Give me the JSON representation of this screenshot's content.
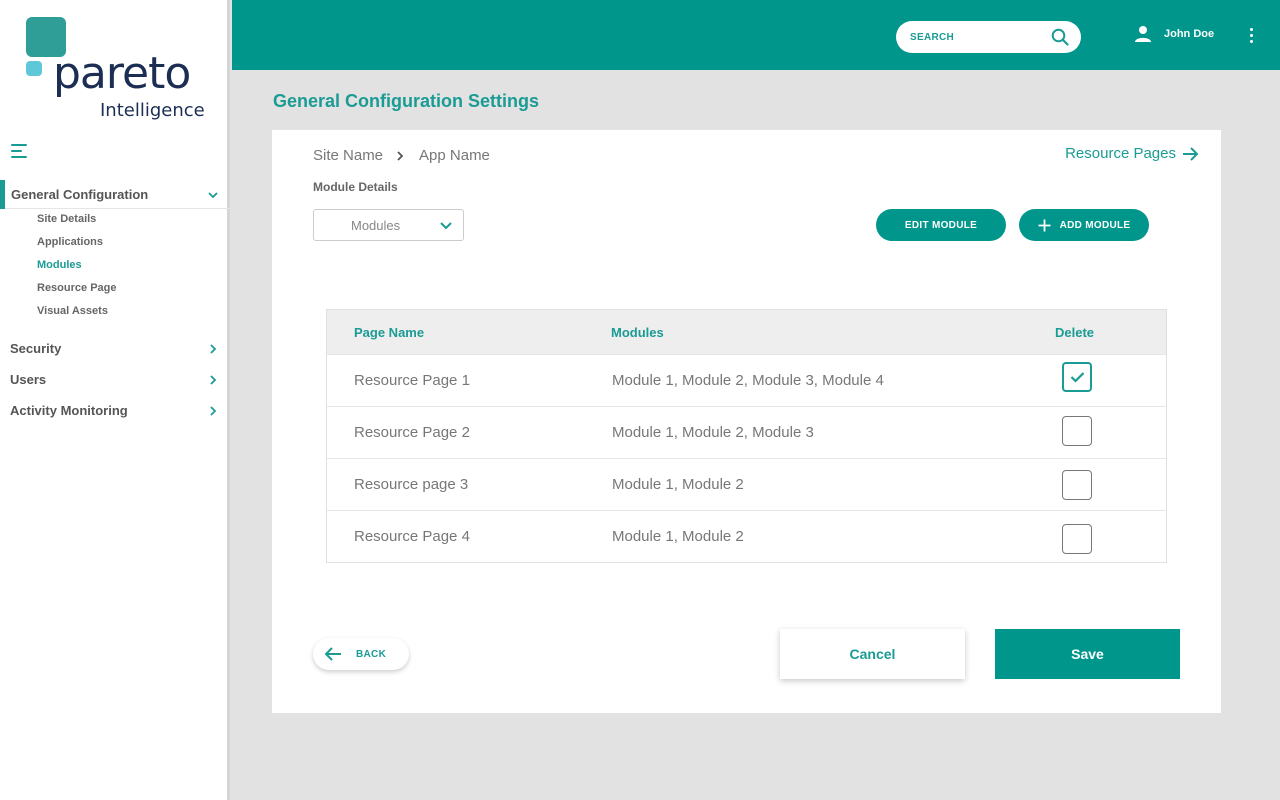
{
  "brand": {
    "logo_word": "pareto",
    "logo_sub": "Intelligence"
  },
  "sidebar": {
    "sections": [
      {
        "label": "General Configuration",
        "expanded": true
      },
      {
        "label": "Security"
      },
      {
        "label": "Users"
      },
      {
        "label": "Activity Monitoring"
      }
    ],
    "sub_items": [
      "Site Details",
      "Applications",
      "Modules",
      "Resource Page",
      "Visual Assets"
    ],
    "active_sub_item": "Modules"
  },
  "header": {
    "search_label": "SEARCH",
    "user_name": "John Doe"
  },
  "page": {
    "title": "General Configuration Settings",
    "breadcrumb": [
      "Site Name",
      "App Name"
    ],
    "resource_link": "Resource Pages",
    "module_details_label": "Module Details",
    "module_select_value": "Modules",
    "edit_button": "EDIT MODULE",
    "add_button": "ADD MODULE"
  },
  "table": {
    "headers": [
      "Page Name",
      "Modules",
      "Delete"
    ],
    "rows": [
      {
        "name": "Resource Page 1",
        "modules": "Module 1, Module 2, Module 3, Module 4",
        "checked": true
      },
      {
        "name": "Resource Page 2",
        "modules": "Module 1, Module 2, Module 3",
        "checked": false
      },
      {
        "name": "Resource page 3",
        "modules": "Module 1, Module 2",
        "checked": false
      },
      {
        "name": "Resource Page 4",
        "modules": "Module 1, Module 2",
        "checked": false
      }
    ]
  },
  "footer": {
    "back_label": "BACK",
    "cancel_label": "Cancel",
    "save_label": "Save"
  },
  "colors": {
    "primary": "#00968c",
    "accent_text": "#1a9b94",
    "logo_navy": "#1c2e54",
    "logo_teal": "#2e9e97",
    "logo_cyan": "#5ec8d8"
  },
  "icons": [
    "hamburger-icon",
    "chevron-down-icon",
    "chevron-right-icon",
    "search-icon",
    "user-icon",
    "kebab-icon",
    "arrow-right-icon",
    "plus-icon",
    "check-icon",
    "arrow-left-icon"
  ]
}
